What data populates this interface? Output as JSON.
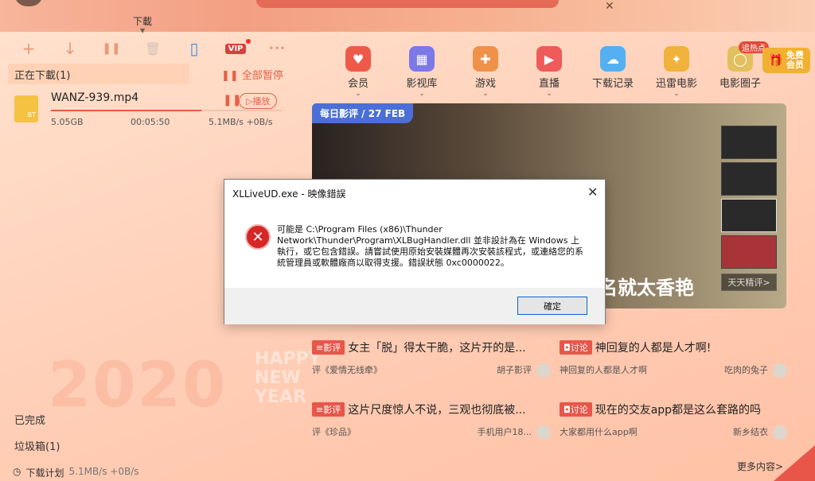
{
  "top": {
    "center_label": "下載",
    "close_glyph": "✕"
  },
  "toolbar": {
    "add": "+",
    "download": "↓",
    "pause": "❚❚",
    "delete": "🗑",
    "phone": "▯",
    "vip": "VIP",
    "more": "•••"
  },
  "downloads": {
    "tab_label": "正在下載(1)",
    "pause_all": "全部暂停",
    "task": {
      "name": "WANZ-939.mp4",
      "type": "BT",
      "size": "5.05GB",
      "time": "00:05:50",
      "speed": "5.1MB/s +0B/s",
      "play": "播放",
      "progress": 0.65
    },
    "completed": "已完成",
    "trash": "垃圾箱(1)",
    "plan": "下载计划",
    "plan_speed": "5.1MB/s +0B/s"
  },
  "background": {
    "year": "2020",
    "new_year": [
      "HAPPY",
      "NEW",
      "YEAR"
    ]
  },
  "nav": [
    {
      "label": "会员",
      "color": "#ee5a4a",
      "glyph": "♥",
      "chevron": true
    },
    {
      "label": "影视库",
      "color": "#7d78e8",
      "glyph": "▦",
      "chevron": true
    },
    {
      "label": "游戏",
      "color": "#f0914a",
      "glyph": "✚",
      "chevron": true
    },
    {
      "label": "直播",
      "color": "#ef5a5a",
      "glyph": "▶",
      "chevron": true
    },
    {
      "label": "下载记录",
      "color": "#54b0f0",
      "glyph": "☁",
      "chevron": false
    },
    {
      "label": "迅雷电影",
      "color": "#f0b23a",
      "glyph": "✦",
      "chevron": true
    },
    {
      "label": "电影圈子",
      "color": "#e2c060",
      "glyph": "◯",
      "chevron": false
    }
  ],
  "nav_extra": {
    "hot_badge": "追热点",
    "free_vip": "免费会员"
  },
  "banner": {
    "tag": "每日影评 / 27 FEB",
    "caption": "名就太香艳",
    "more": "天天精评>"
  },
  "posts": [
    {
      "badge": "≡影评",
      "title": "女主「脱」得太干脆，这片开的是...",
      "sub_left": "评《爱情无线牵》",
      "sub_right": "胡子影评"
    },
    {
      "badge": "◘讨论",
      "title": "神回复的人都是人才啊!",
      "sub_left": "神回复的人都是人才啊",
      "sub_right": "吃肉的兔子"
    },
    {
      "badge": "≡影评",
      "title": "这片尺度惊人不说，三观也彻底被...",
      "sub_left": "评《珍品》",
      "sub_right": "手机用户18..."
    },
    {
      "badge": "◘讨论",
      "title": "现在的交友app都是这么套路的吗",
      "sub_left": "大家都用什么app啊",
      "sub_right": "新乡结衣"
    }
  ],
  "more_content": "更多内容>",
  "dialog": {
    "title": "XLLiveUD.exe - 映像錯誤",
    "close": "✕",
    "error_glyph": "✕",
    "message": "可能是 C:\\Program Files (x86)\\Thunder Network\\Thunder\\Program\\XLBugHandler.dll 並非設計為在 Windows 上執行，或它包含錯誤。請嘗試使用原始安裝媒體再次安裝該程式，或連絡您的系統管理員或軟體廠商以取得支援。錯誤狀態 0xc0000022。",
    "ok": "確定"
  }
}
